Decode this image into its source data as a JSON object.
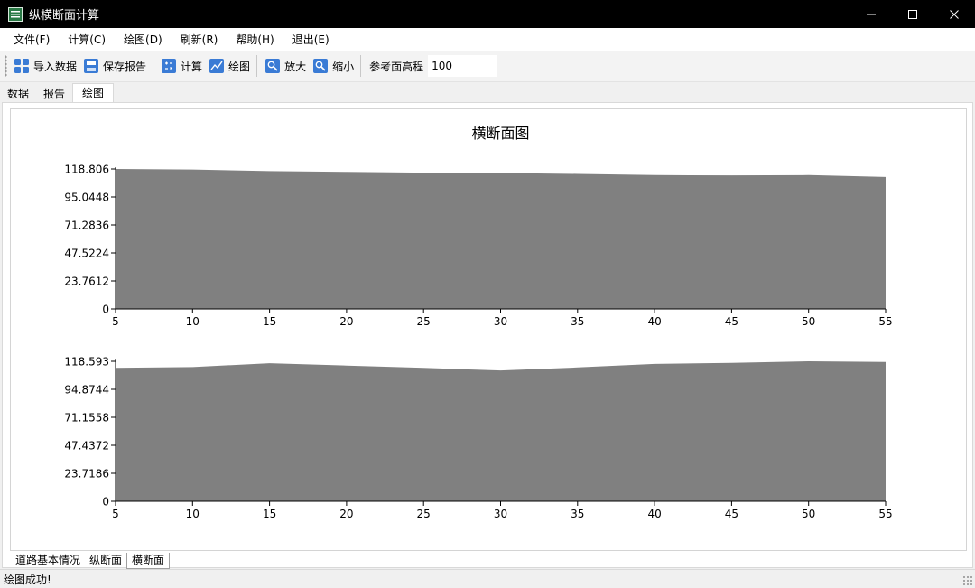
{
  "window": {
    "title": "纵横断面计算",
    "icon": "app-logo-icon",
    "controls": [
      "minimize-icon",
      "maximize-icon",
      "close-icon"
    ]
  },
  "menu": {
    "file": "文件(F)",
    "calc": "计算(C)",
    "draw": "绘图(D)",
    "refresh": "刷新(R)",
    "help": "帮助(H)",
    "exit": "退出(E)"
  },
  "toolbar": {
    "import": "导入数据",
    "save_report": "保存报告",
    "calculate": "计算",
    "draw": "绘图",
    "zoom_in": "放大",
    "zoom_out": "缩小",
    "ref_height_label": "参考面高程",
    "ref_height_value": "100"
  },
  "tabs_top": [
    "数据",
    "报告",
    "绘图"
  ],
  "tabs_bottom": [
    "道路基本情况",
    "纵断面",
    "横断面"
  ],
  "status": "绘图成功!",
  "colors": {
    "area_fill": "#808080",
    "axis": "#000000",
    "accent_icon": "#3a7bd5",
    "titlebar": "#000000"
  },
  "chart_data": [
    {
      "type": "area",
      "title": "横断面图",
      "xlabel": "",
      "ylabel": "",
      "x": [
        5,
        10,
        15,
        20,
        25,
        30,
        35,
        40,
        45,
        50,
        55
      ],
      "values": [
        118.806,
        118.3,
        117.0,
        116.3,
        115.6,
        115.4,
        114.6,
        113.6,
        113.3,
        113.6,
        112.0
      ],
      "ylim": [
        0,
        118.806
      ],
      "xlim": [
        5,
        55
      ],
      "x_ticks": [
        "5",
        "10",
        "15",
        "20",
        "25",
        "30",
        "35",
        "40",
        "45",
        "50",
        "55"
      ],
      "y_ticks": [
        "0",
        "23.7612",
        "47.5224",
        "71.2836",
        "95.0448",
        "118.806"
      ],
      "grid": false
    },
    {
      "type": "area",
      "title": "",
      "xlabel": "",
      "ylabel": "",
      "x": [
        5,
        10,
        15,
        20,
        25,
        30,
        35,
        40,
        45,
        50,
        55
      ],
      "values": [
        113.0,
        113.7,
        117.0,
        115.0,
        113.0,
        110.8,
        113.4,
        116.4,
        117.3,
        118.593,
        118.0
      ],
      "ylim": [
        0,
        118.593
      ],
      "xlim": [
        5,
        55
      ],
      "x_ticks": [
        "5",
        "10",
        "15",
        "20",
        "25",
        "30",
        "35",
        "40",
        "45",
        "50",
        "55"
      ],
      "y_ticks": [
        "0",
        "23.7186",
        "47.4372",
        "71.1558",
        "94.8744",
        "118.593"
      ],
      "grid": false
    }
  ]
}
